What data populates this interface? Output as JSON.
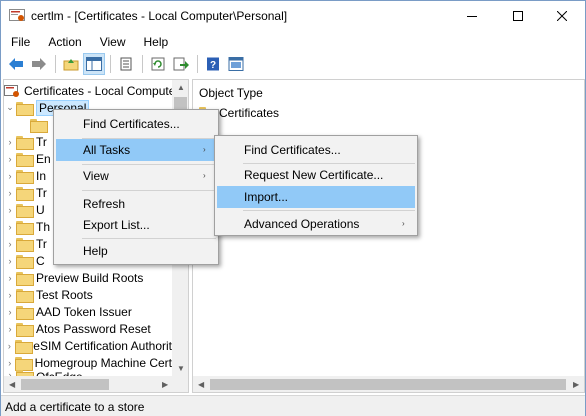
{
  "window": {
    "title": "certlm - [Certificates - Local Computer\\Personal]"
  },
  "menubar": [
    "File",
    "Action",
    "View",
    "Help"
  ],
  "toolbar": {
    "icons": [
      "back-arrow-icon",
      "forward-arrow-icon",
      "up-folder-icon",
      "show-hide-tree-icon",
      "properties-icon",
      "refresh-icon",
      "export-list-icon",
      "help-icon",
      "mmc-icon"
    ]
  },
  "tree": {
    "root": "Certificates - Local Computer",
    "selected": "Personal",
    "items": [
      {
        "label": "",
        "partial": true
      },
      {
        "label": "Tr",
        "partial": true
      },
      {
        "label": "En",
        "partial": true
      },
      {
        "label": "In",
        "partial": true
      },
      {
        "label": "Tr",
        "partial": true
      },
      {
        "label": "U",
        "partial": true
      },
      {
        "label": "Th",
        "partial": true
      },
      {
        "label": "Tr",
        "partial": true
      },
      {
        "label": "C",
        "partial": true
      },
      {
        "label": "Preview Build Roots"
      },
      {
        "label": "Test Roots"
      },
      {
        "label": "AAD Token Issuer"
      },
      {
        "label": "Atos Password Reset"
      },
      {
        "label": "eSIM Certification Authorit"
      },
      {
        "label": "Homegroup Machine Cert"
      },
      {
        "label": "OfcEdge"
      }
    ]
  },
  "right_pane": {
    "column_header": "Object Type",
    "rows": [
      "Certificates"
    ]
  },
  "context_menu": {
    "items": [
      "Find Certificates...",
      "All Tasks",
      "View",
      "Refresh",
      "Export List...",
      "Help"
    ],
    "highlighted": "All Tasks"
  },
  "submenu": {
    "items": [
      "Find Certificates...",
      "Request New Certificate...",
      "Import...",
      "Advanced Operations"
    ],
    "highlighted": "Import..."
  },
  "statusbar": {
    "text": "Add a certificate to a store"
  }
}
